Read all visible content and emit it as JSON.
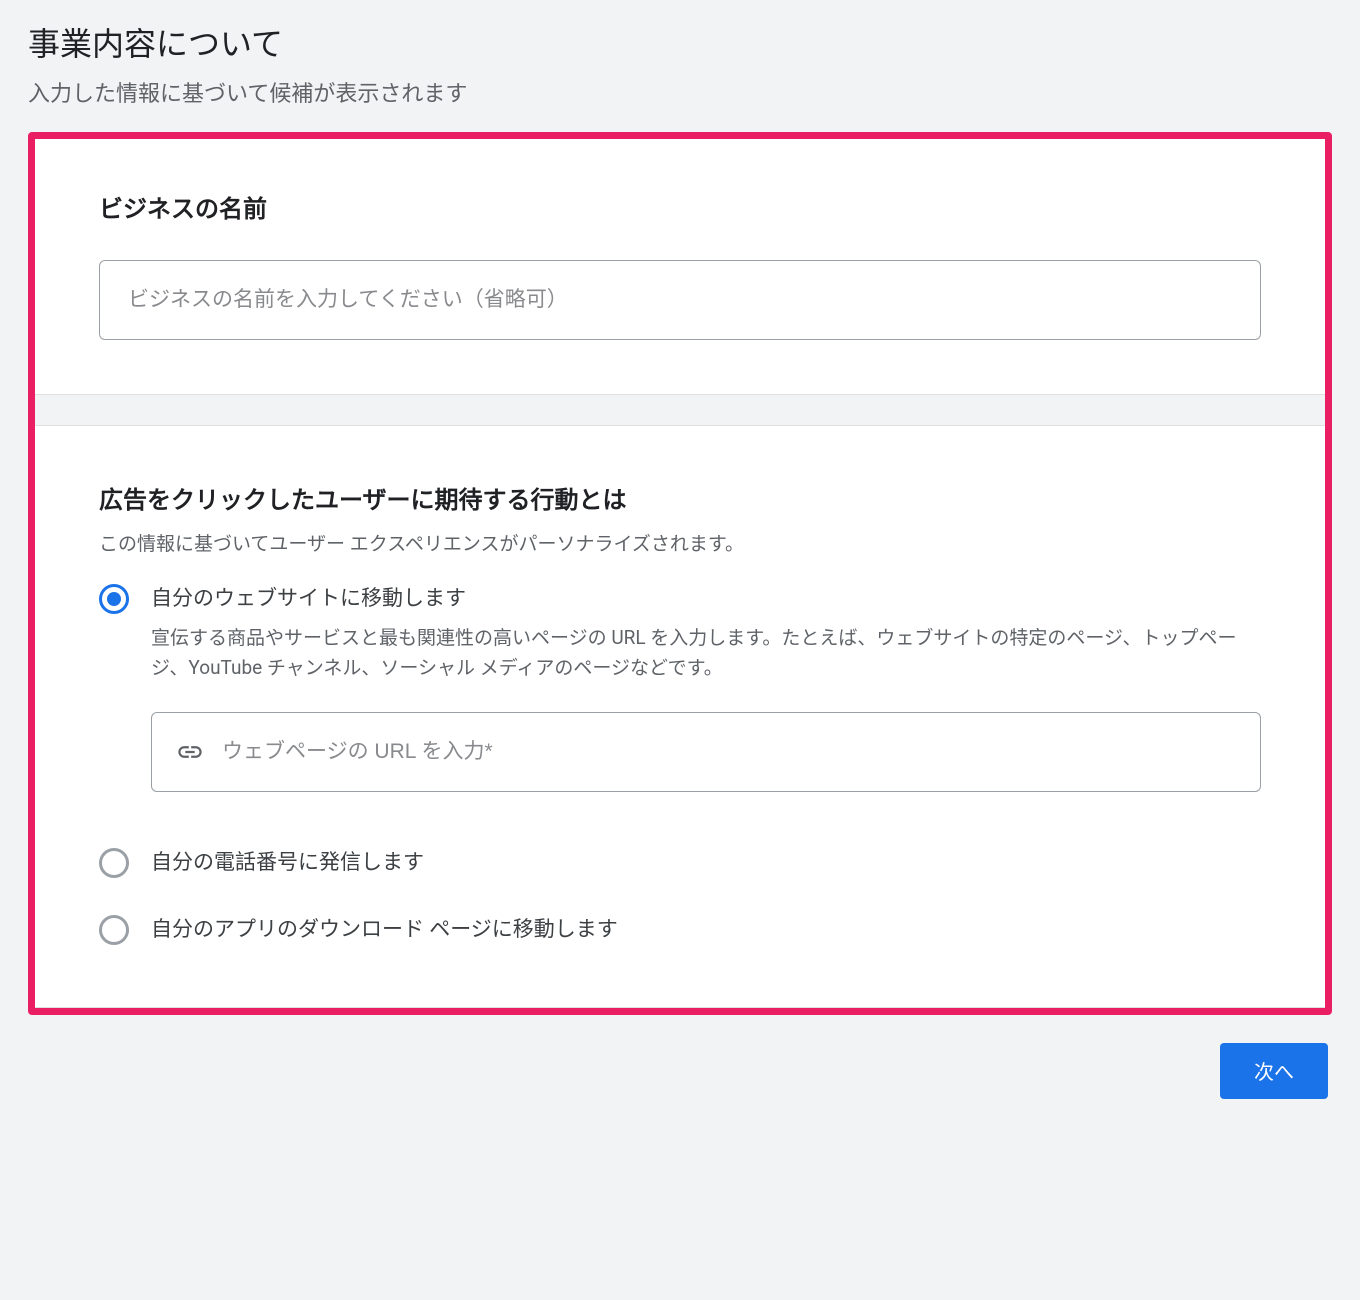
{
  "header": {
    "title": "事業内容について",
    "subtitle": "入力した情報に基づいて候補が表示されます"
  },
  "business_name": {
    "section_title": "ビジネスの名前",
    "placeholder": "ビジネスの名前を入力してください（省略可）",
    "value": ""
  },
  "action": {
    "section_title": "広告をクリックしたユーザーに期待する行動とは",
    "section_sub": "この情報に基づいてユーザー エクスペリエンスがパーソナライズされます。",
    "options": [
      {
        "label": "自分のウェブサイトに移動します",
        "description": "宣伝する商品やサービスと最も関連性の高いページの URL を入力します。たとえば、ウェブサイトの特定のページ、トップページ、YouTube チャンネル、ソーシャル メディアのページなどです。",
        "selected": true,
        "url_placeholder": "ウェブページの URL を入力*",
        "url_value": ""
      },
      {
        "label": "自分の電話番号に発信します",
        "selected": false
      },
      {
        "label": "自分のアプリのダウンロード ページに移動します",
        "selected": false
      }
    ]
  },
  "footer": {
    "next_label": "次へ"
  }
}
